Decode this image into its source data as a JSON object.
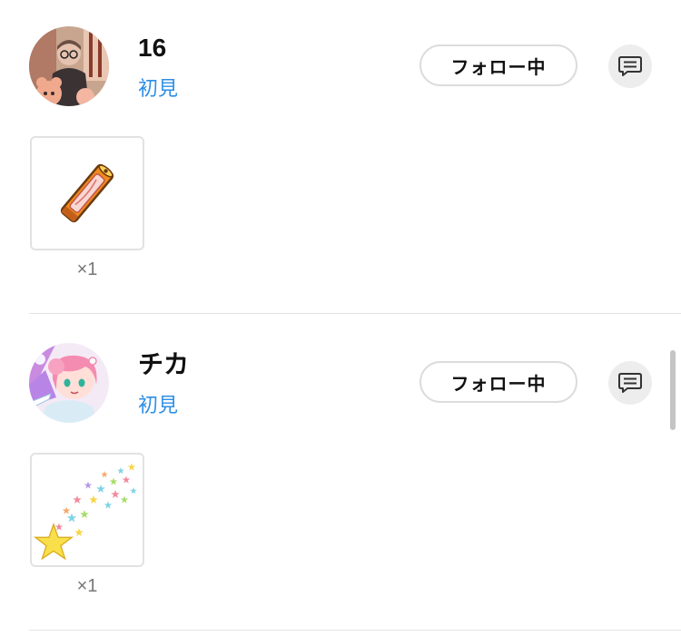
{
  "entries": [
    {
      "user_name": "16",
      "tag": "初見",
      "follow_label": "フォロー中",
      "gift": {
        "name": "glowstick",
        "count": "×1"
      }
    },
    {
      "user_name": "チカ",
      "tag": "初見",
      "follow_label": "フォロー中",
      "gift": {
        "name": "shooting-stars",
        "count": "×1"
      }
    }
  ],
  "icons": {
    "message": "chat-bubble-icon",
    "gift_1": "glowstick-icon",
    "gift_2": "star-shower-icon"
  },
  "colors": {
    "tag_blue": "#2e8fe6",
    "button_border": "#dcdcdc",
    "message_bg": "#ededed",
    "divider": "#e4e4e4"
  }
}
